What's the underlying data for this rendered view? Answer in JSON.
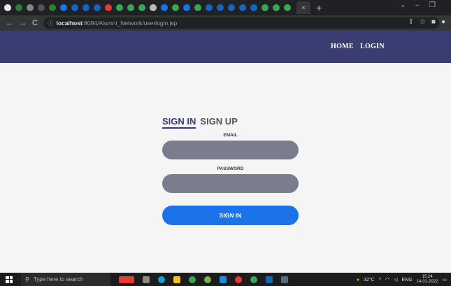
{
  "browser": {
    "tab_icons": [
      "#e8eaed",
      "#2e7d32",
      "#888",
      "#555",
      "#2e7d32",
      "#1a73e8",
      "#1565c0",
      "#1565c0",
      "#1565c0",
      "#e53935",
      "#34a853",
      "#34a853",
      "#34a853",
      "#bbb",
      "#1a73e8",
      "#34a853",
      "#1a73e8",
      "#34a853",
      "#1565c0",
      "#1565c0",
      "#1565c0",
      "#1565c0",
      "#1565c0",
      "#34a853",
      "#34a853",
      "#34a853"
    ],
    "close_tab": "×",
    "new_tab": "+",
    "url_host": "localhost",
    "url_path": ":8084/Alumni_Network/userlogin.jsp"
  },
  "nav": {
    "home": "HOME",
    "login": "LOGIN",
    "bg_color": "#3a3d72"
  },
  "form": {
    "tab_signin": "SIGN IN",
    "tab_signup": "SIGN UP",
    "email_label": "EMAIL",
    "password_label": "PASSWORD",
    "email_value": "",
    "password_value": "",
    "submit_label": "SIGN IN",
    "button_color": "#1a73e8",
    "input_color": "#7a7d8c"
  },
  "taskbar": {
    "search_placeholder": "Type here to search",
    "temperature": "32°C",
    "language": "ENG",
    "time": "15:24",
    "date": "14-01-2022"
  }
}
